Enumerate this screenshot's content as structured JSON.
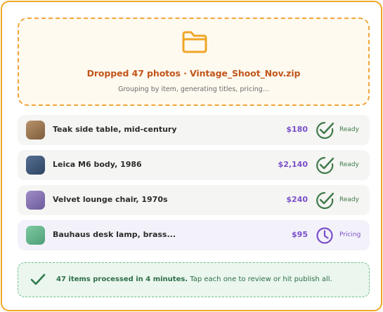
{
  "dropzone": {
    "icon": "folder-icon",
    "title": "Dropped 47 photos · Vintage_Shoot_Nov.zip",
    "subtitle": "Grouping by item, generating titles, pricing..."
  },
  "items": [
    {
      "title": "Teak side table, mid-century",
      "price": "$180",
      "status": "Ready",
      "thumb_color": "#a07c57",
      "status_icon": "check-icon"
    },
    {
      "title": "Leica M6 body, 1986",
      "price": "$2,140",
      "status": "Ready",
      "thumb_color": "#3f5a7c",
      "status_icon": "check-icon"
    },
    {
      "title": "Velvet lounge chair, 1970s",
      "price": "$240",
      "status": "Ready",
      "thumb_color": "#8b79b4",
      "status_icon": "check-icon"
    },
    {
      "title": "Bauhaus desk lamp, brass...",
      "price": "$95",
      "status": "Pricing",
      "thumb_color": "#6dbb94",
      "status_icon": "clock-icon"
    }
  ],
  "banner": {
    "icon": "check-icon",
    "bold": "47 items processed in 4 minutes.",
    "rest": " Tap each one to review or hit publish all."
  },
  "colors": {
    "accent_orange": "#f0a828",
    "price_purple": "#7a4fc9",
    "ready_green": "#3f7a4a"
  }
}
